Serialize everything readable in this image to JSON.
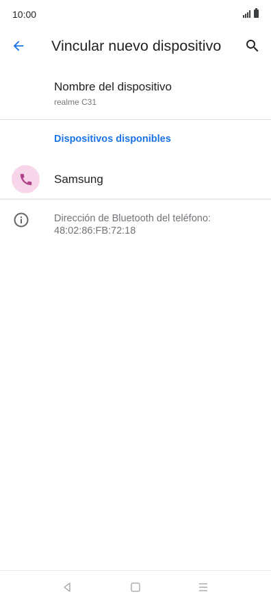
{
  "status_bar": {
    "time": "10:00"
  },
  "header": {
    "title": "Vincular nuevo dispositivo"
  },
  "device_name": {
    "label": "Nombre del dispositivo",
    "value": "realme C31"
  },
  "available": {
    "header": "Dispositivos disponibles",
    "devices": [
      {
        "name": "Samsung",
        "icon": "phone-icon"
      }
    ]
  },
  "info": {
    "text": "Dirección de Bluetooth del teléfono: 48:02:86:FB:72:18"
  },
  "icons": {
    "back": "arrow-back-icon",
    "search": "search-icon",
    "info": "info-icon",
    "nav_back": "nav-back-icon",
    "nav_home": "nav-home-icon",
    "nav_menu": "nav-menu-icon"
  },
  "colors": {
    "accent": "#1a73e8",
    "device_avatar_bg": "#f8d6ea",
    "device_icon": "#b0458a",
    "secondary_text": "#70757a",
    "divider": "#dadce0"
  }
}
